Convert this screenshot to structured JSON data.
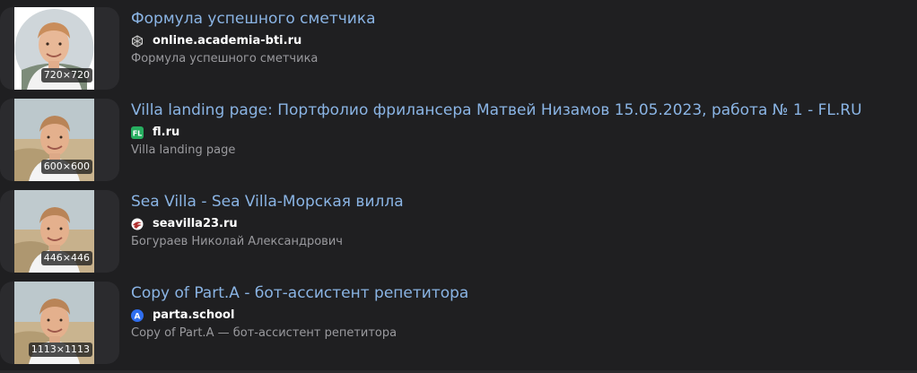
{
  "results": [
    {
      "title": "Формула успешного сметчика",
      "site": "online.academia-bti.ru",
      "favicon": "academia-cube-icon",
      "snippet": "Формула успешного сметчика",
      "size": "720×720",
      "thumb_style": "round"
    },
    {
      "title": "Villa landing page: Портфолио фрилансера Матвей Низамов 15.05.2023, работа № 1 - FL.RU",
      "site": "fl.ru",
      "favicon": "fl-icon",
      "favicon_text": "FL",
      "favicon_color": "#27ae60",
      "snippet": "Villa landing page",
      "size": "600×600",
      "thumb_style": "beach"
    },
    {
      "title": "Sea Villa - Sea Villa-Морская вилла",
      "site": "seavilla23.ru",
      "favicon": "seavilla-icon",
      "snippet": "Богураев Николай Александрович",
      "size": "446×446",
      "thumb_style": "beach"
    },
    {
      "title": "Copy of Part.A - бот-ассистент репетитора",
      "site": "parta.school",
      "favicon": "parta-a-icon",
      "favicon_text": "A",
      "favicon_color": "#2f6ef0",
      "snippet": "Copy of Part.A — бот-ассистент репетитора",
      "size": "1113×1113",
      "thumb_style": "beach"
    }
  ],
  "colors": {
    "background": "#1f1f21",
    "title_link": "#8ab4e4",
    "snippet": "#9a9a9e"
  }
}
